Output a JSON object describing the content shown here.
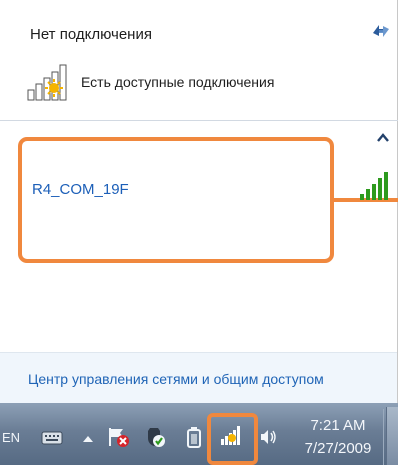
{
  "flyout": {
    "status_title": "Нет подключения",
    "available_text": "Есть доступные подключения",
    "networks": [
      {
        "name": "R4_COM_19F",
        "signal_bars": 5,
        "signal_color": "#2e9a1e"
      }
    ],
    "footer_link": "Центр управления сетями и общим доступом",
    "icons": [
      "refresh-icon",
      "network-warning-icon",
      "collapse-arrow-icon",
      "wifi-signal-icon"
    ]
  },
  "taskbar": {
    "language": "EN",
    "clock": {
      "time": "7:21 AM",
      "date": "7/27/2009"
    },
    "tray_icons": [
      "keyboard-icon",
      "show-hidden-icons",
      "action-center-flag-icon",
      "security-shield-icon",
      "battery-icon",
      "network-warning-icon",
      "volume-icon"
    ]
  },
  "colors": {
    "highlight_outline": "#f0883e",
    "link": "#1f64b6",
    "network_name": "#1c5fb8",
    "taskbar_top": "#8da0b6",
    "taskbar_bottom": "#566a83"
  }
}
